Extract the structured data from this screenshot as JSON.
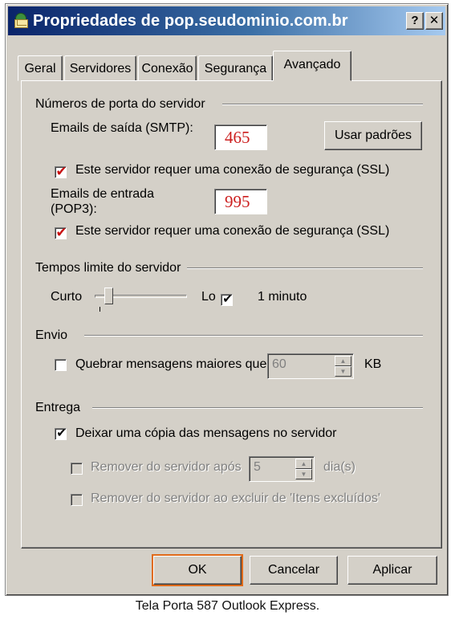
{
  "window": {
    "title": "Propriedades de pop.seudominio.com.br",
    "help_button": "?",
    "close_button": "✕"
  },
  "tabs": [
    {
      "label": "Geral",
      "active": false
    },
    {
      "label": "Servidores",
      "active": false
    },
    {
      "label": "Conexão",
      "active": false
    },
    {
      "label": "Segurança",
      "active": false
    },
    {
      "label": "Avançado",
      "active": true
    }
  ],
  "ports": {
    "group_title": "Números de porta do servidor",
    "smtp_label": "Emails de saída (SMTP):",
    "smtp_value": "465",
    "defaults_button": "Usar padrões",
    "smtp_ssl_label": "Este servidor requer uma conexão de segurança (SSL)",
    "smtp_ssl_checked": true,
    "pop3_label_line1": "Emails de entrada",
    "pop3_label_line2": "(POP3):",
    "pop3_value": "995",
    "pop3_ssl_label": "Este servidor requer uma conexão de segurança (SSL)",
    "pop3_ssl_checked": true,
    "highlight_color": "#c81010"
  },
  "timeouts": {
    "group_title": "Tempos limite do servidor",
    "short_label": "Curto",
    "long_label": "Lo",
    "long_checked": true,
    "value_text": "1 minuto",
    "slider_position": 0.1
  },
  "sending": {
    "group_title": "Envio",
    "split_label": "Quebrar mensagens maiores que",
    "split_checked": false,
    "split_value": "60",
    "unit": "KB"
  },
  "delivery": {
    "group_title": "Entrega",
    "leave_copy_label": "Deixar uma cópia das mensagens no servidor",
    "leave_copy_checked": true,
    "remove_after_label": "Remover do servidor após",
    "remove_after_checked": false,
    "remove_after_value": "5",
    "remove_after_unit": "dia(s)",
    "remove_deleted_label": "Remover do servidor ao excluir de 'Itens excluídos'",
    "remove_deleted_checked": false
  },
  "footer": {
    "ok": "OK",
    "cancel": "Cancelar",
    "apply": "Aplicar",
    "default_outline_color": "#e06b1a"
  },
  "caption": "Tela Porta 587 Outlook Express."
}
